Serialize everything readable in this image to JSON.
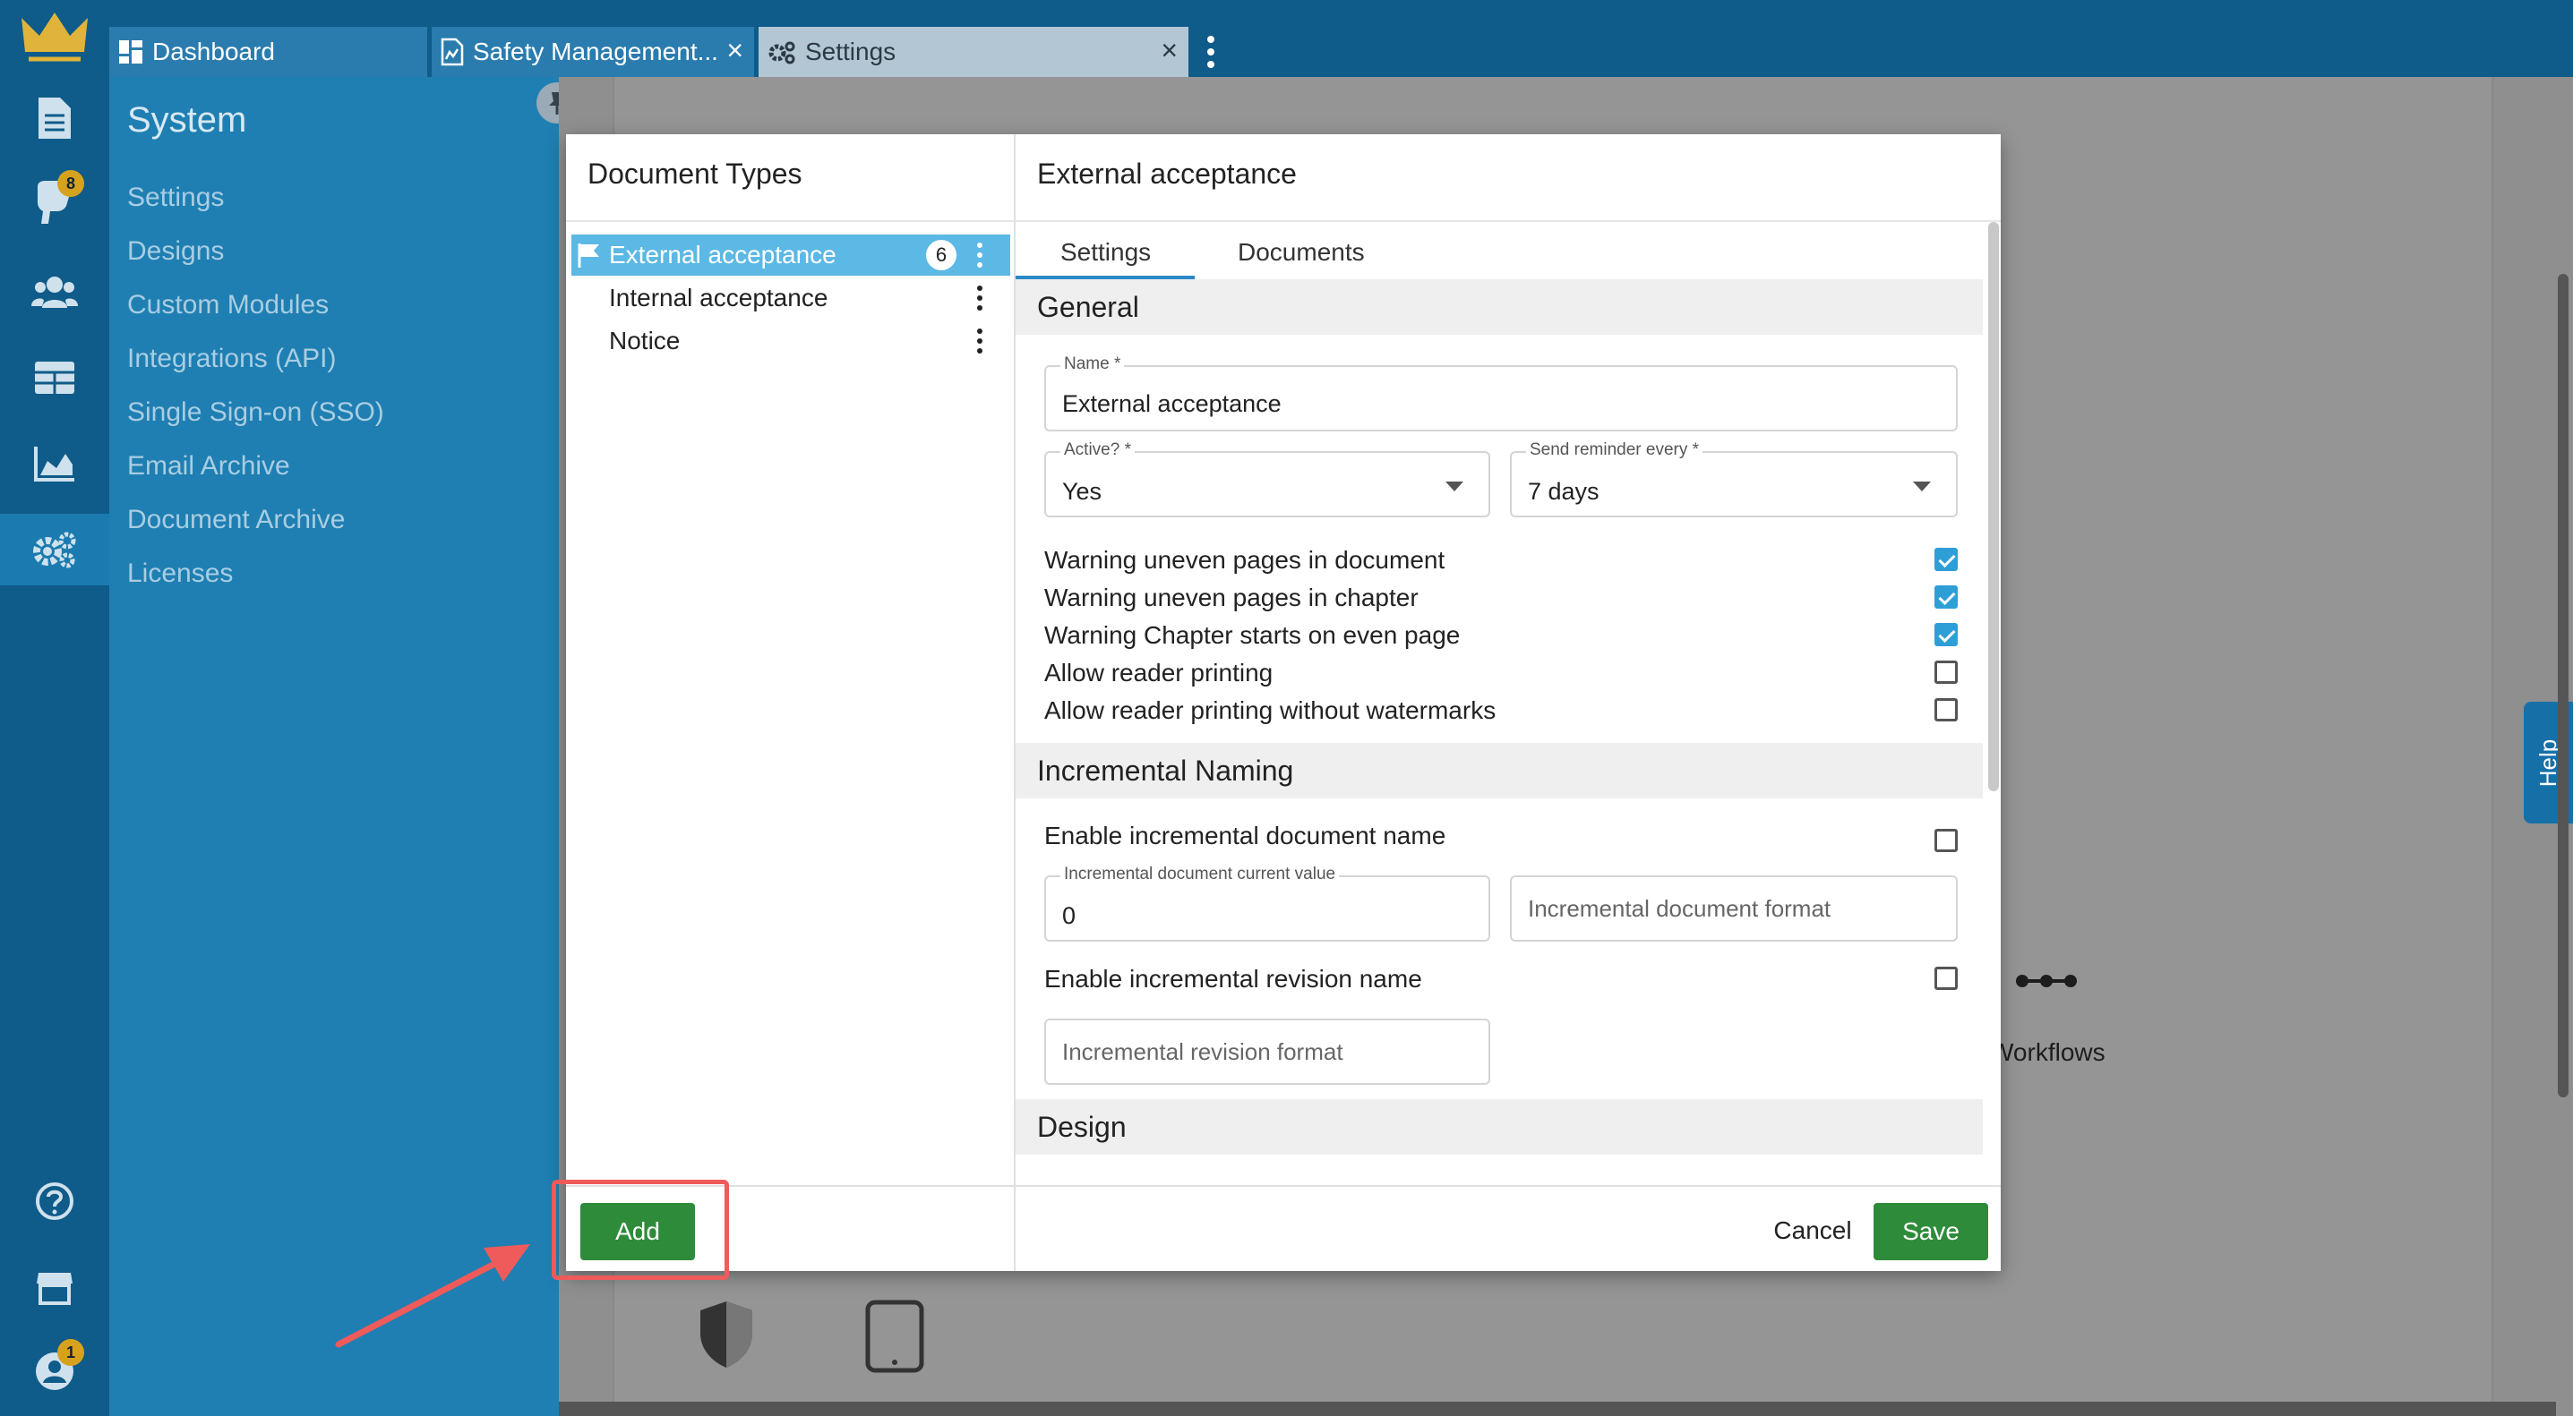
{
  "tabs": [
    {
      "label": "Dashboard"
    },
    {
      "label": "Safety Management..."
    },
    {
      "label": "Settings"
    }
  ],
  "rail": {
    "notifications_badge": "8",
    "profile_badge": "1"
  },
  "system": {
    "title": "System",
    "items": [
      "Settings",
      "Designs",
      "Custom Modules",
      "Integrations (API)",
      "Single Sign-on (SSO)",
      "Email Archive",
      "Document Archive",
      "Licenses"
    ]
  },
  "background": {
    "workflows_label": "Workflows",
    "help_label": "Help"
  },
  "modal": {
    "left_title": "Document Types",
    "document_types": [
      {
        "label": "External acceptance",
        "count": "6"
      },
      {
        "label": "Internal acceptance",
        "count": ""
      },
      {
        "label": "Notice",
        "count": ""
      }
    ],
    "add_label": "Add",
    "right_title": "External acceptance",
    "subtabs": [
      "Settings",
      "Documents"
    ],
    "sections": {
      "general": "General",
      "incremental": "Incremental Naming",
      "design": "Design"
    },
    "fields": {
      "name_label": "Name *",
      "name_value": "External acceptance",
      "active_label": "Active? *",
      "active_value": "Yes",
      "reminder_label": "Send reminder every *",
      "reminder_value": "7 days",
      "inc_doc_current_label": "Incremental document current value",
      "inc_doc_current_value": "0",
      "inc_doc_format_placeholder": "Incremental document format",
      "inc_rev_format_placeholder": "Incremental revision format"
    },
    "checks": [
      {
        "label": "Warning uneven pages in document",
        "checked": true
      },
      {
        "label": "Warning uneven pages in chapter",
        "checked": true
      },
      {
        "label": "Warning Chapter starts on even page",
        "checked": true
      },
      {
        "label": "Allow reader printing",
        "checked": false
      },
      {
        "label": "Allow reader printing without watermarks",
        "checked": false
      }
    ],
    "inc_doc_enable": {
      "label": "Enable incremental document name",
      "checked": false
    },
    "inc_rev_enable": {
      "label": "Enable incremental revision name",
      "checked": false
    },
    "cancel_label": "Cancel",
    "save_label": "Save"
  },
  "colors": {
    "rail": "#0f5b8a",
    "sidebar": "#1f7fb2",
    "selected_row": "#5cb8e4",
    "primary_button": "#2e8b3a",
    "checkbox_on": "#2e9fd6",
    "highlight": "#ef5a5a"
  }
}
